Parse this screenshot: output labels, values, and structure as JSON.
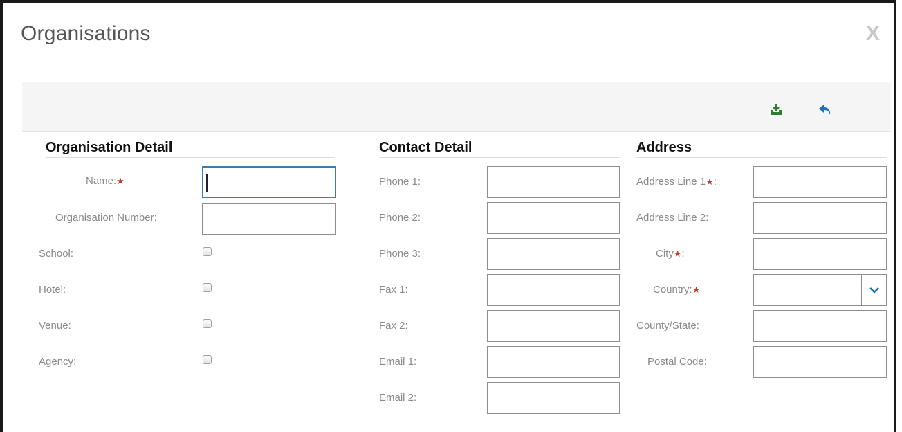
{
  "dialog": {
    "title": "Organisations",
    "close_label": "X"
  },
  "toolbar": {
    "save_icon": "save-download-icon",
    "back_icon": "back-arrow-icon",
    "colors": {
      "save": "#2e7d32",
      "back": "#1f6fb5"
    }
  },
  "organisation": {
    "heading": "Organisation Detail",
    "name_label": "Name:",
    "name_value": "",
    "number_label": "Organisation Number:",
    "number_value": "",
    "school_label": "School:",
    "hotel_label": "Hotel:",
    "venue_label": "Venue:",
    "agency_label": "Agency:"
  },
  "contact": {
    "heading": "Contact Detail",
    "phone1_label": "Phone 1:",
    "phone2_label": "Phone 2:",
    "phone3_label": "Phone 3:",
    "fax1_label": "Fax 1:",
    "fax2_label": "Fax 2:",
    "email1_label": "Email 1:",
    "email2_label": "Email 2:"
  },
  "address": {
    "heading": "Address",
    "line1_label": "Address Line 1",
    "line2_label": "Address Line 2:",
    "city_label": "City",
    "country_label": "Country:",
    "county_label": "County/State:",
    "postal_label": "Postal Code:",
    "country_value": ""
  },
  "colors": {
    "required_star": "#c0392b",
    "focus_border": "#3e7ab5",
    "label_text": "#8a8a8a"
  }
}
